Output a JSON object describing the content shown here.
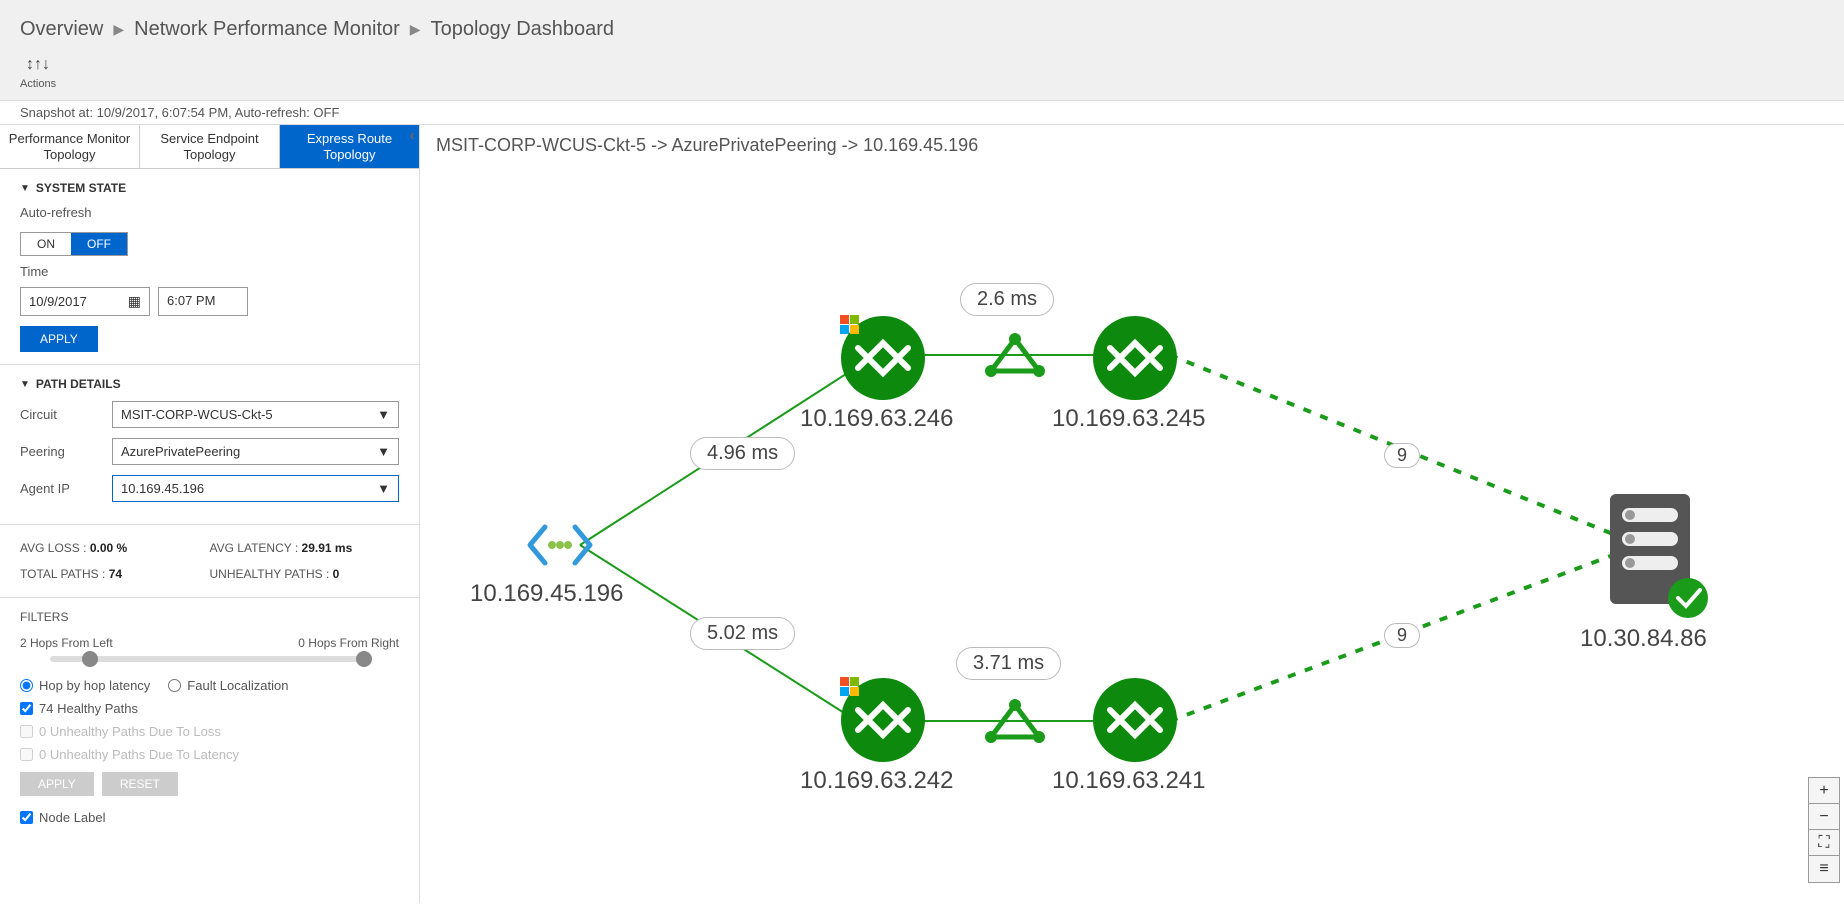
{
  "breadcrumb": [
    "Overview",
    "Network Performance Monitor",
    "Topology Dashboard"
  ],
  "actions": {
    "label": "Actions"
  },
  "snapshot": "Snapshot at: 10/9/2017, 6:07:54 PM, Auto-refresh: OFF",
  "tabs": [
    {
      "line1": "Performance Monitor",
      "line2": "Topology"
    },
    {
      "line1": "Service Endpoint",
      "line2": "Topology"
    },
    {
      "line1": "Express Route",
      "line2": "Topology"
    }
  ],
  "activeTab": 2,
  "systemState": {
    "title": "SYSTEM STATE",
    "autoRefreshLabel": "Auto-refresh",
    "on": "ON",
    "off": "OFF",
    "offActive": true,
    "timeLabel": "Time",
    "date": "10/9/2017",
    "time": "6:07 PM",
    "apply": "APPLY"
  },
  "pathDetails": {
    "title": "PATH DETAILS",
    "circuitLabel": "Circuit",
    "circuit": "MSIT-CORP-WCUS-Ckt-5",
    "peeringLabel": "Peering",
    "peering": "AzurePrivatePeering",
    "agentLabel": "Agent IP",
    "agent": "10.169.45.196"
  },
  "stats": {
    "avgLossLabel": "AVG LOSS :",
    "avgLoss": "0.00 %",
    "avgLatencyLabel": "AVG LATENCY :",
    "avgLatency": "29.91 ms",
    "totalPathsLabel": "TOTAL PATHS :",
    "totalPaths": "74",
    "unhealthyLabel": "UNHEALTHY PATHS :",
    "unhealthy": "0"
  },
  "filters": {
    "title": "FILTERS",
    "leftHops": "2 Hops From Left",
    "rightHops": "0 Hops From Right",
    "hopLatency": "Hop by hop latency",
    "faultLoc": "Fault Localization",
    "healthyPaths": "74 Healthy Paths",
    "unhealthyLoss": "0 Unhealthy Paths Due To Loss",
    "unhealthyLatency": "0 Unhealthy Paths Due To Latency",
    "apply": "APPLY",
    "reset": "RESET",
    "nodeLabel": "Node Label"
  },
  "canvas": {
    "title": "MSIT-CORP-WCUS-Ckt-5 -> AzurePrivatePeering -> 10.169.45.196",
    "nodes": {
      "source": "10.169.45.196",
      "n246": "10.169.63.246",
      "n245": "10.169.63.245",
      "n242": "10.169.63.242",
      "n241": "10.169.63.241",
      "dest": "10.30.84.86"
    },
    "edges": {
      "e1": "4.96 ms",
      "e2": "2.6 ms",
      "e3": "5.02 ms",
      "e4": "3.71 ms",
      "h1": "9",
      "h2": "9"
    }
  }
}
